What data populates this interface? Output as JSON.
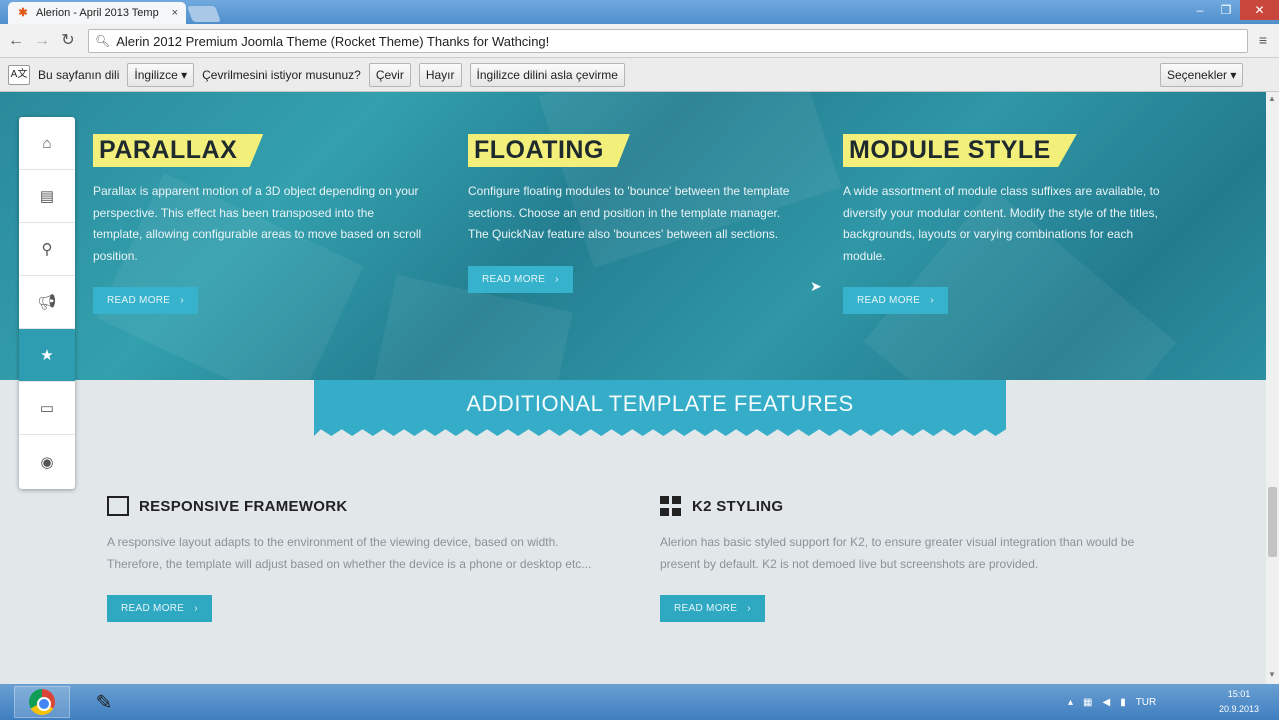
{
  "browser": {
    "tab_title": "Alerion - April 2013 Temp",
    "tab_close": "×",
    "address": "Alerin 2012 Premium Joomla Theme (Rocket Theme) Thanks for Wathcing!",
    "window_min": "–",
    "window_max": "❐",
    "window_close": "✕"
  },
  "translate_bar": {
    "prompt_prefix": "Bu sayfanın dili",
    "language": "İngilizce",
    "question": "Çevrilmesini istiyor musunuz?",
    "translate": "Çevir",
    "no": "Hayır",
    "never": "İngilizce dilini asla çevirme",
    "options": "Seçenekler"
  },
  "features": [
    {
      "title": "PARALLAX",
      "description": "Parallax is apparent motion of a 3D object depending on your perspective. This effect has been transposed into the template, allowing configurable areas to move based on scroll position.",
      "button": "READ MORE"
    },
    {
      "title": "FLOATING",
      "description": "Configure floating modules to 'bounce' between the template sections. Choose an end position in the template manager. The QuickNav feature also 'bounces' between all sections.",
      "button": "READ MORE"
    },
    {
      "title": "MODULE STYLE",
      "description": "A wide assortment of module class suffixes are available, to diversify your modular content. Modify the style of the titles, backgrounds, layouts or varying combinations for each module.",
      "button": "READ MORE"
    }
  ],
  "ribbon_title": "ADDITIONAL TEMPLATE FEATURES",
  "lower_features": [
    {
      "title": "RESPONSIVE FRAMEWORK",
      "description": "A responsive layout adapts to the environment of the viewing device, based on width. Therefore, the template will adjust based on whether the device is a phone or desktop etc...",
      "button": "READ MORE"
    },
    {
      "title": "K2 STYLING",
      "description": "Alerion has basic styled support for K2, to ensure greater visual integration than would be present by default. K2 is not demoed live but screenshots are provided.",
      "button": "READ MORE"
    }
  ],
  "quicknav_icons": [
    "home-icon",
    "browser-icon",
    "map-pin-icon",
    "megaphone-icon",
    "star-icon",
    "monitor-icon",
    "globe-icon"
  ],
  "taskbar": {
    "lang": "TUR",
    "time": "15:01",
    "date": "20.9.2013"
  },
  "colors": {
    "teal": "#2b8e9e",
    "ribbon": "#35adc8",
    "highlight": "#f2ef7b",
    "button": "#36b2cc"
  }
}
